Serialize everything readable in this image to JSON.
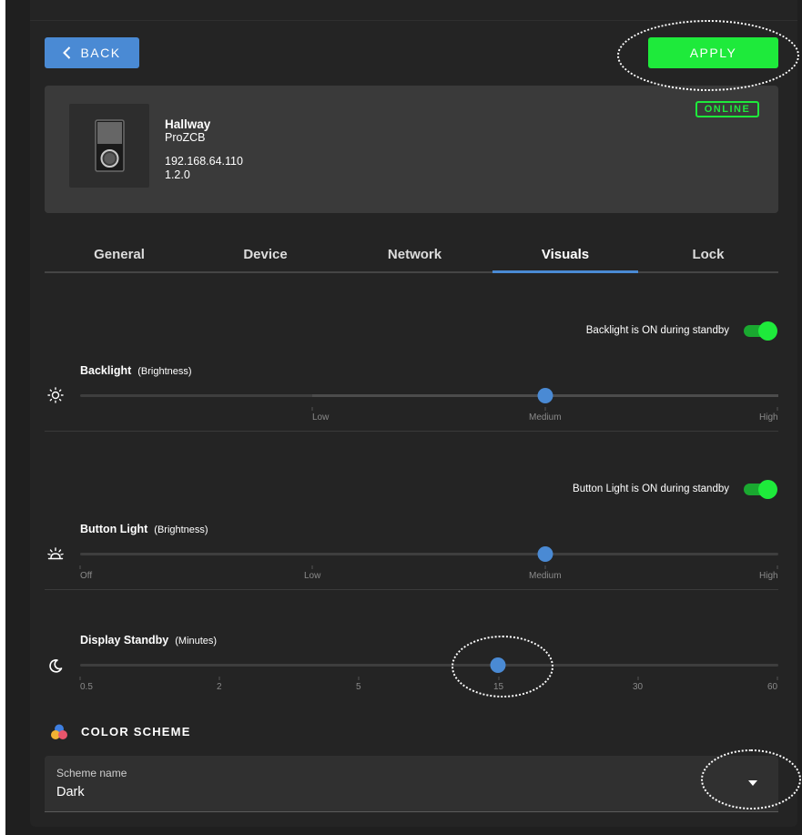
{
  "header": {
    "back_label": "BACK",
    "apply_label": "APPLY"
  },
  "device": {
    "name": "Hallway",
    "model": "ProZCB",
    "ip": "192.168.64.110",
    "version": "1.2.0",
    "status": "ONLINE"
  },
  "tabs": [
    {
      "label": "General"
    },
    {
      "label": "Device"
    },
    {
      "label": "Network"
    },
    {
      "label": "Visuals"
    },
    {
      "label": "Lock"
    }
  ],
  "active_tab": "Visuals",
  "backlight": {
    "standby_text": "Backlight is ON during standby",
    "standby_on": true,
    "title": "Backlight",
    "unit": "(Brightness)",
    "ticks": [
      "Low",
      "Medium",
      "High"
    ],
    "value": "Medium",
    "icon": "sun-icon"
  },
  "button_light": {
    "standby_text": "Button Light is ON during standby",
    "standby_on": true,
    "title": "Button Light",
    "unit": "(Brightness)",
    "ticks": [
      "Off",
      "Low",
      "Medium",
      "High"
    ],
    "value": "Medium",
    "icon": "button-light-icon"
  },
  "display_standby": {
    "title": "Display Standby",
    "unit": "(Minutes)",
    "ticks": [
      "0.5",
      "2",
      "5",
      "15",
      "30",
      "60"
    ],
    "value": "15",
    "icon": "moon-icon"
  },
  "color_scheme": {
    "title": "COLOR SCHEME",
    "field_label": "Scheme name",
    "value": "Dark",
    "icon": "palette-icon"
  },
  "colors": {
    "accent": "#4a8ad4",
    "success": "#1eea3b",
    "background": "#242424",
    "card": "#3a3a3a"
  }
}
